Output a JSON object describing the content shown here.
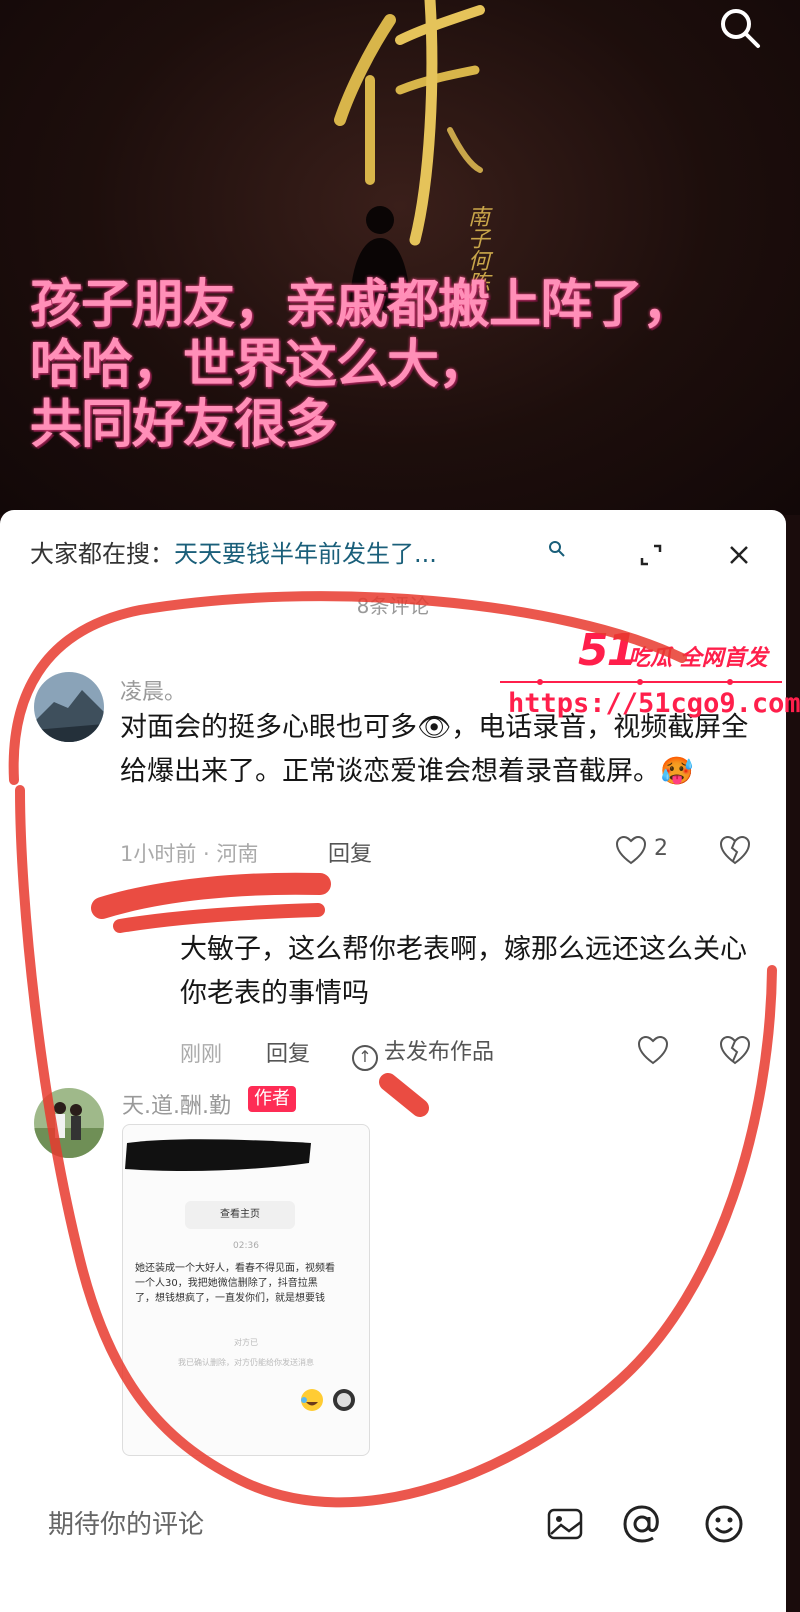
{
  "video": {
    "vertical_text": "南子何陈",
    "overlay_lines": [
      "孩子朋友，亲戚都搬上阵了，",
      "哈哈，世界这么大，",
      "共同好友很多"
    ],
    "search_icon": "search-icon"
  },
  "sheet": {
    "search_prefix": "大家都在搜：",
    "search_query": "天天要钱半年前发生了...",
    "comment_count": "8条评论",
    "comments": [
      {
        "username": "凌晨。",
        "text": "对面会的挺多心眼也可多👁，电话录音，视频截屏全给爆出来了。正常谈恋爱谁会想着录音截屏。🥵",
        "meta": "1小时前 · 河南",
        "reply_label": "回复",
        "like_count": "2"
      },
      {
        "username": "天.道.酬.勤",
        "badge": "作者",
        "image": {
          "button": "查看主页",
          "time": "02:36",
          "text": "她还装成一个大好人，看春不得见面，视频看一个人30，我把她微信删除了，抖音拉黑了，想钱想疯了，一直发你们，就是想要钱",
          "foot1": "对方已",
          "foot2": "我已确认删除，对方仍能给你发送消息"
        }
      }
    ],
    "reply": {
      "text": "大敏子，这么帮你老表啊，嫁那么远还这么关心你老表的事情吗",
      "meta": "刚刚",
      "reply_label": "回复",
      "publish_label": "去发布作品"
    },
    "input_placeholder": "期待你的评论"
  },
  "watermark": {
    "number": "51",
    "tag": "吃瓜 全网首发",
    "url": "https://51cgo9.com"
  },
  "colors": {
    "overlay_pink": "#ff8fb8",
    "annotation_red": "#e8392e",
    "watermark_red": "#ff1f4b",
    "badge_red": "#fe2c55"
  }
}
